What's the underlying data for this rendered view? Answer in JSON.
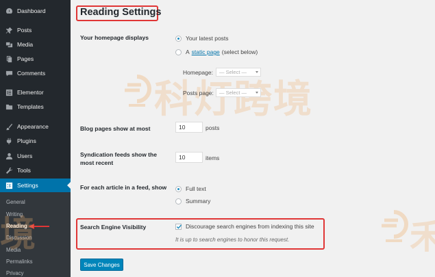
{
  "sidebar": {
    "menu": [
      {
        "label": "Dashboard",
        "icon": "dashboard-icon"
      },
      {
        "label": "Posts",
        "icon": "pin-icon"
      },
      {
        "label": "Media",
        "icon": "media-icon"
      },
      {
        "label": "Pages",
        "icon": "pages-icon"
      },
      {
        "label": "Comments",
        "icon": "comments-icon"
      },
      {
        "label": "Elementor",
        "icon": "elementor-icon"
      },
      {
        "label": "Templates",
        "icon": "folder-icon"
      },
      {
        "label": "Appearance",
        "icon": "brush-icon"
      },
      {
        "label": "Plugins",
        "icon": "plugin-icon"
      },
      {
        "label": "Users",
        "icon": "user-icon"
      },
      {
        "label": "Tools",
        "icon": "wrench-icon"
      },
      {
        "label": "Settings",
        "icon": "settings-icon"
      }
    ],
    "submenu": [
      "General",
      "Writing",
      "Reading",
      "Discussion",
      "Media",
      "Permalinks",
      "Privacy"
    ],
    "active_color": "#0073aa"
  },
  "page": {
    "title": "Reading Settings"
  },
  "homepage": {
    "label": "Your homepage displays",
    "option_latest": "Your latest posts",
    "option_static_prefix": "A",
    "option_static_link": "static page",
    "option_static_suffix": "(select below)",
    "homepage_label": "Homepage:",
    "homepage_value": "— Select —",
    "postspage_label": "Posts page:",
    "postspage_value": "— Select —"
  },
  "blog_pages": {
    "label": "Blog pages show at most",
    "value": "10",
    "unit": "posts"
  },
  "syndication": {
    "label": "Syndication feeds show the most recent",
    "value": "10",
    "unit": "items"
  },
  "feed_article": {
    "label": "For each article in a feed, show",
    "option_full": "Full text",
    "option_summary": "Summary"
  },
  "seo": {
    "label": "Search Engine Visibility",
    "checkbox_label": "Discourage search engines from indexing this site",
    "description": "It is up to search engines to honor this request."
  },
  "actions": {
    "save_label": "Save Changes"
  },
  "watermark": {
    "text": "科灯跨境",
    "text_right": "禾",
    "text_left": "境"
  },
  "colors": {
    "highlight_border": "#e03535",
    "primary_button": "#0085ba",
    "link": "#0073aa"
  }
}
